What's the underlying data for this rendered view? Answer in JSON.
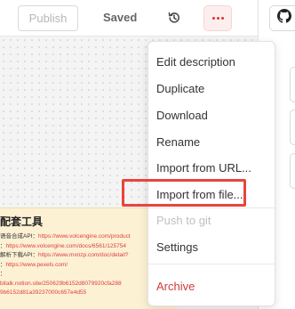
{
  "toolbar": {
    "publish_label": "Publish",
    "saved_label": "Saved",
    "history_icon": "history-icon",
    "more_icon": "more-horizontal-icon",
    "github_icon": "github-icon"
  },
  "menu": {
    "items": [
      {
        "label": "Edit description"
      },
      {
        "label": "Duplicate"
      },
      {
        "label": "Download"
      },
      {
        "label": "Rename"
      },
      {
        "label": "Import from URL..."
      },
      {
        "label": "Import from file..."
      },
      {
        "label": "Push to git",
        "disabled": true
      },
      {
        "label": "Settings"
      },
      {
        "label": "Archive",
        "danger": true
      }
    ]
  },
  "note": {
    "title": "配套工具",
    "lines": [
      {
        "prefix": "语音合成API：",
        "link": "https://www.volcengine.com/product"
      },
      {
        "prefix": "：",
        "link": "https://www.volcengine.com/docs/6561/125754"
      },
      {
        "prefix": "解析下载API：",
        "link": "https://www.mxnzp.com/doc/detail?"
      },
      {
        "prefix": "：",
        "link": "https://www.pexels.com/"
      },
      {
        "prefix": "：",
        "link": ""
      },
      {
        "prefix": "",
        "link": "bitalk.notion.site/250629b6152d8079920cfa288"
      },
      {
        "prefix": "",
        "link": "9b6152d81a39237000c657e4d55"
      }
    ]
  },
  "colors": {
    "accent_red": "#e8453c",
    "danger": "#d23a3a",
    "note_bg": "#fdf1d4"
  }
}
